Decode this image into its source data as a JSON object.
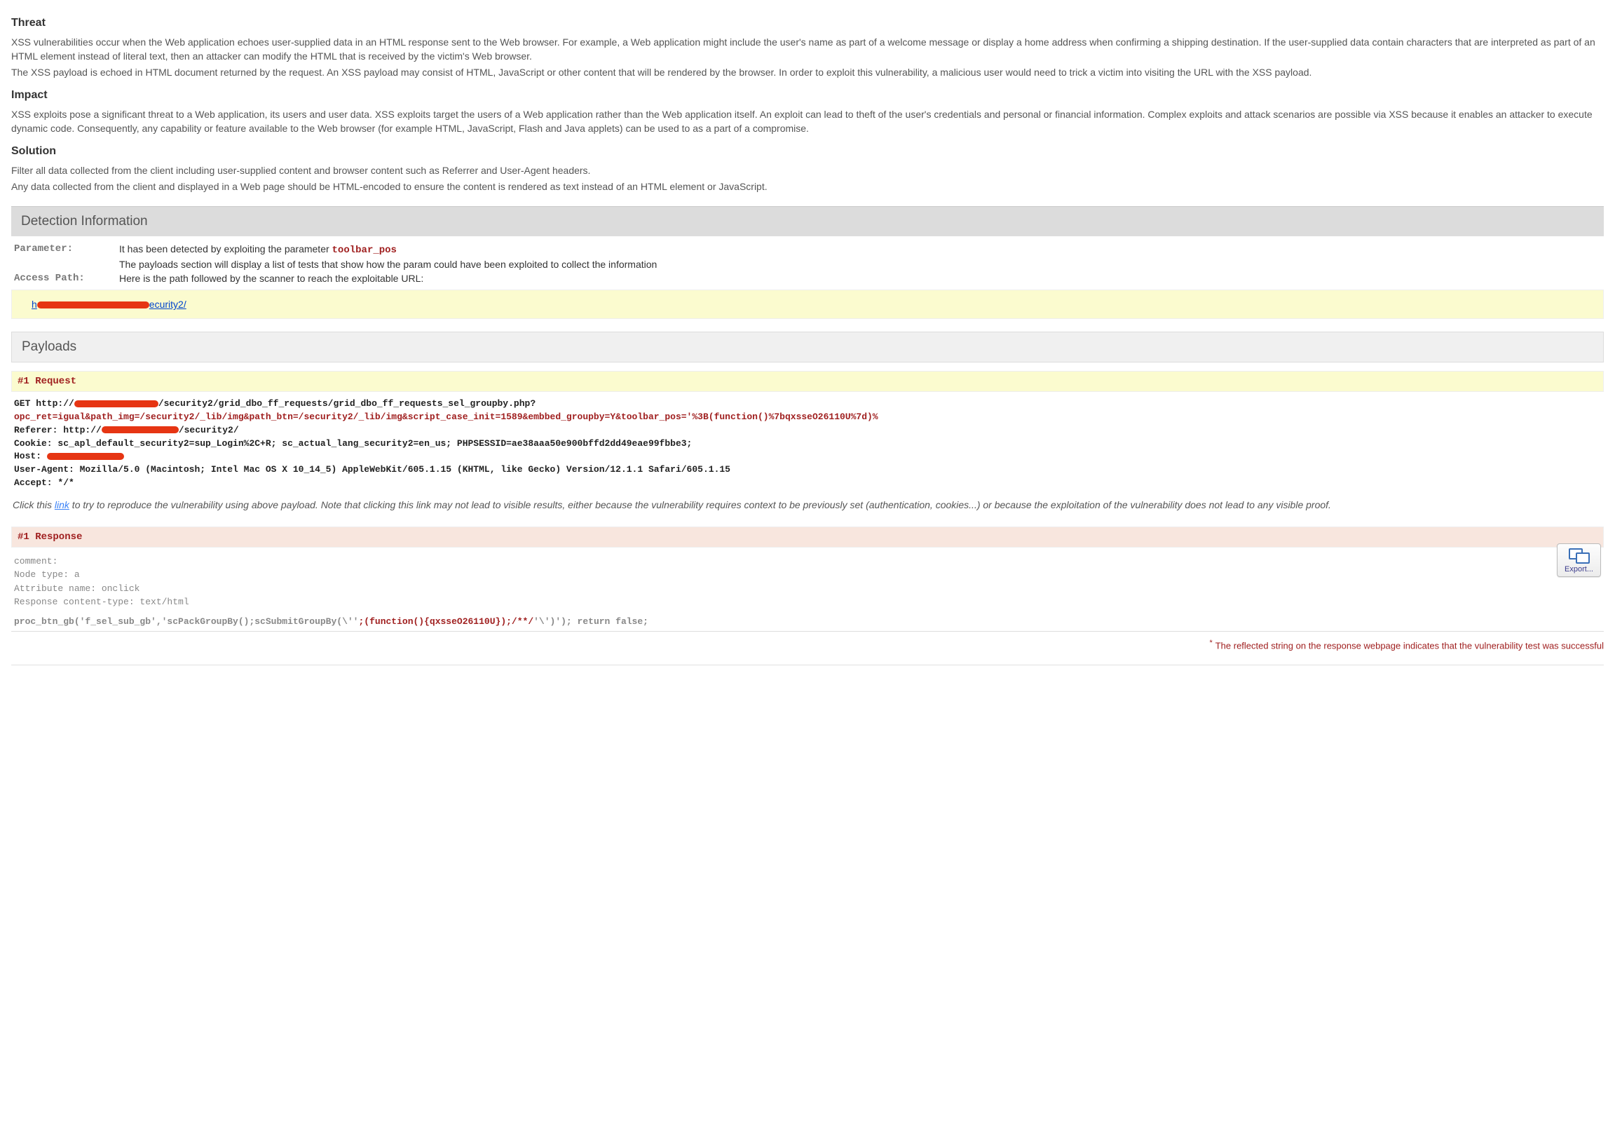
{
  "threat": {
    "heading": "Threat",
    "p1": "XSS vulnerabilities occur when the Web application echoes user-supplied data in an HTML response sent to the Web browser. For example, a Web application might include the user's name as part of a welcome message or display a home address when confirming a shipping destination. If the user-supplied data contain characters that are interpreted as part of an HTML element instead of literal text, then an attacker can modify the HTML that is received by the victim's Web browser.",
    "p2": "The XSS payload is echoed in HTML document returned by the request. An XSS payload may consist of HTML, JavaScript or other content that will be rendered by the browser. In order to exploit this vulnerability, a malicious user would need to trick a victim into visiting the URL with the XSS payload."
  },
  "impact": {
    "heading": "Impact",
    "p1": "XSS exploits pose a significant threat to a Web application, its users and user data. XSS exploits target the users of a Web application rather than the Web application itself. An exploit can lead to theft of the user's credentials and personal or financial information. Complex exploits and attack scenarios are possible via XSS because it enables an attacker to execute dynamic code. Consequently, any capability or feature available to the Web browser (for example HTML, JavaScript, Flash and Java applets) can be used to as a part of a compromise."
  },
  "solution": {
    "heading": "Solution",
    "p1": "Filter all data collected from the client including user-supplied content and browser content such as Referrer and User-Agent headers.",
    "p2": "Any data collected from the client and displayed in a Web page should be HTML-encoded to ensure the content is rendered as text instead of an HTML element or JavaScript."
  },
  "detection": {
    "title": "Detection Information",
    "param_label": "Parameter:",
    "param_text_pre": "It has been detected by exploiting the parameter ",
    "param_name": "toolbar_pos",
    "param_text2": "The payloads section will display a list of tests that show how the param could have been exploited to collect the information",
    "access_label": "Access Path:",
    "access_text": "Here is the path followed by the scanner to reach the exploitable URL:",
    "path_prefix": "h",
    "path_suffix": "ecurity2/"
  },
  "payloads": {
    "title": "Payloads",
    "request_label": "#1 Request",
    "get_prefix": "GET http://",
    "get_path": "/security2/grid_dbo_ff_requests/grid_dbo_ff_requests_sel_groupby.php?",
    "params": "opc_ret=igual&path_img=/security2/_lib/img&path_btn=/security2/_lib/img&script_case_init=1589&embbed_groupby=Y&toolbar_pos='%3B(function()%7bqxsseO26110U%7d)%",
    "referer_pre": "Referer: http://",
    "referer_suf": "/security2/",
    "cookie": "Cookie: sc_apl_default_security2=sup_Login%2C+R; sc_actual_lang_security2=en_us; PHPSESSID=ae38aaa50e900bffd2dd49eae99fbbe3;",
    "host": "Host: ",
    "ua": "User-Agent: Mozilla/5.0 (Macintosh; Intel Mac OS X 10_14_5) AppleWebKit/605.1.15 (KHTML, like Gecko) Version/12.1.1 Safari/605.1.15",
    "accept": "Accept: */*",
    "note_pre": "Click this ",
    "note_link": "link",
    "note_post": " to try to reproduce the vulnerability using above payload. Note that clicking this link may not lead to visible results, either because the vulnerability requires context to be previously set (authentication, cookies...) or because the exploitation of the vulnerability does not lead to any visible proof.",
    "response_label": "#1 Response",
    "resp_comment": "comment:",
    "resp_node": "Node type: a",
    "resp_attr": "Attribute name: onclick",
    "resp_ct": "Response content-type: text/html",
    "resp_code_pre": "proc_btn_gb('f_sel_sub_gb','scPackGroupBy();scSubmitGroupBy(\\''",
    "resp_code_inject": ";(function(){qxsseO26110U});/**/",
    "resp_code_post": "'\\')'); return false;",
    "export_label": "Export...",
    "footnote": "The reflected string on the response webpage indicates that the vulnerability test was successful"
  }
}
